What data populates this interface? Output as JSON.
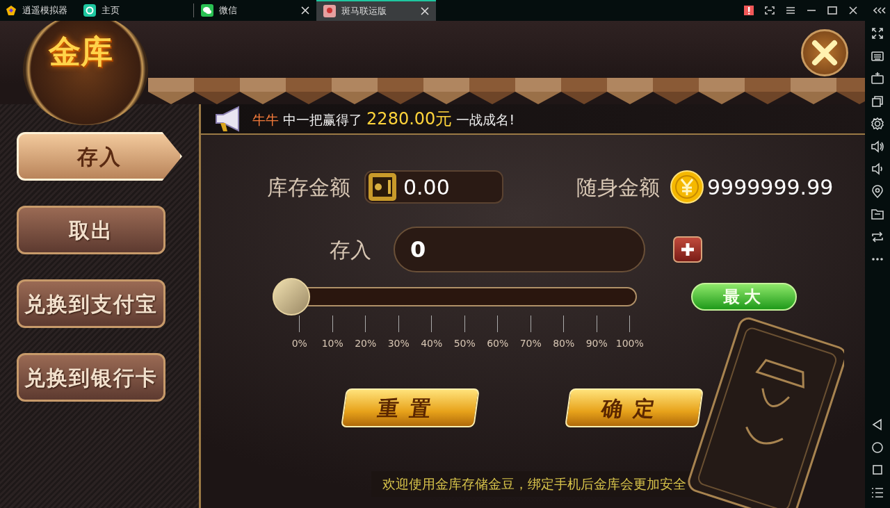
{
  "emulator": {
    "app_name": "逍遥模拟器"
  },
  "tabs": [
    {
      "label": "主页",
      "selected": false,
      "closable": false
    },
    {
      "label": "微信",
      "selected": false,
      "closable": true
    },
    {
      "label": "斑马联运版",
      "selected": true,
      "closable": true
    }
  ],
  "game": {
    "title": "金库",
    "broadcast": {
      "player": "牛牛",
      "before": "中一把赢得了",
      "amount": "2280.00元",
      "after": "一战成名!"
    },
    "menu": [
      {
        "label": "存入",
        "selected": true
      },
      {
        "label": "取出",
        "selected": false
      },
      {
        "label": "兑换到支付宝",
        "selected": false
      },
      {
        "label": "兑换到银行卡",
        "selected": false
      }
    ],
    "vault_balance": {
      "label": "库存金额",
      "value": "0.00"
    },
    "wallet_balance": {
      "label": "随身金额",
      "value": "9999999.99"
    },
    "deposit": {
      "label": "存入",
      "value": "0"
    },
    "slider": {
      "level": 0,
      "ticks": [
        "0%",
        "10%",
        "20%",
        "30%",
        "40%",
        "50%",
        "60%",
        "70%",
        "80%",
        "90%",
        "100%"
      ]
    },
    "max_button": "最大",
    "buttons": [
      "重置",
      "确定"
    ],
    "notice": "欢迎使用金库存储金豆，绑定手机后金库会更加安全"
  }
}
